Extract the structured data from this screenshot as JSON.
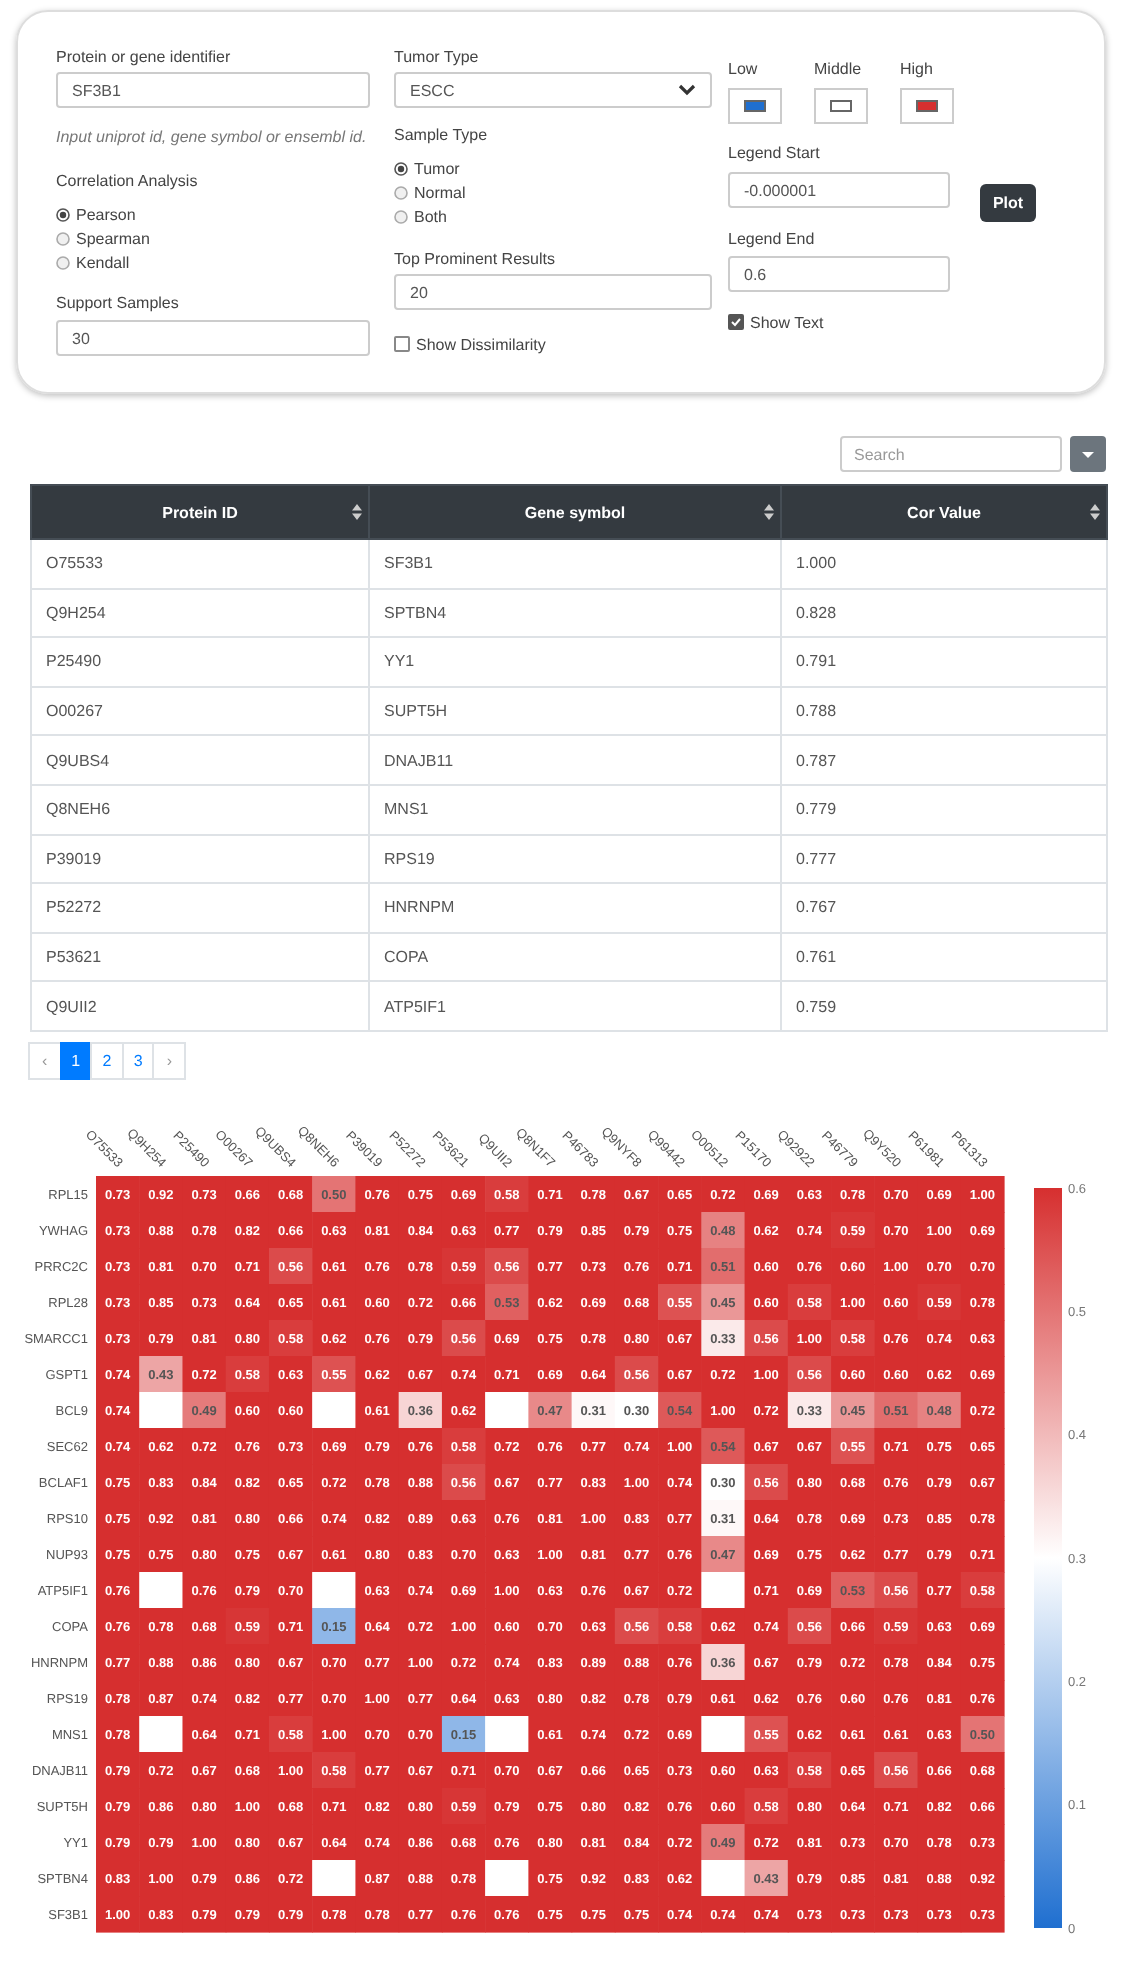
{
  "form": {
    "identifier": {
      "label": "Protein or gene identifier",
      "value": "SF3B1",
      "hint": "Input uniprot id, gene symbol or ensembl id."
    },
    "correlation": {
      "label": "Correlation Analysis",
      "options": [
        {
          "label": "Pearson",
          "selected": true
        },
        {
          "label": "Spearman",
          "selected": false
        },
        {
          "label": "Kendall",
          "selected": false
        }
      ]
    },
    "support_samples": {
      "label": "Support Samples",
      "value": "30"
    },
    "tumor_type": {
      "label": "Tumor Type",
      "value": "ESCC"
    },
    "sample_type": {
      "label": "Sample Type",
      "options": [
        {
          "label": "Tumor",
          "selected": true
        },
        {
          "label": "Normal",
          "selected": false
        },
        {
          "label": "Both",
          "selected": false
        }
      ]
    },
    "top_results": {
      "label": "Top Prominent Results",
      "value": "20"
    },
    "show_dissimilarity": {
      "label": "Show Dissimilarity",
      "checked": false
    },
    "colors": [
      {
        "label": "Low",
        "color": "#1f6fd0"
      },
      {
        "label": "Middle",
        "color": "#ffffff"
      },
      {
        "label": "High",
        "color": "#d62f2f"
      }
    ],
    "legend_start": {
      "label": "Legend Start",
      "value": "-0.000001"
    },
    "legend_end": {
      "label": "Legend End",
      "value": "0.6"
    },
    "show_text": {
      "label": "Show Text",
      "checked": true
    },
    "plot_button": "Plot"
  },
  "table": {
    "search_placeholder": "Search",
    "columns": [
      "Protein ID",
      "Gene symbol",
      "Cor Value"
    ],
    "rows": [
      [
        "O75533",
        "SF3B1",
        "1.000"
      ],
      [
        "Q9H254",
        "SPTBN4",
        "0.828"
      ],
      [
        "P25490",
        "YY1",
        "0.791"
      ],
      [
        "O00267",
        "SUPT5H",
        "0.788"
      ],
      [
        "Q9UBS4",
        "DNAJB11",
        "0.787"
      ],
      [
        "Q8NEH6",
        "MNS1",
        "0.779"
      ],
      [
        "P39019",
        "RPS19",
        "0.777"
      ],
      [
        "P52272",
        "HNRNPM",
        "0.767"
      ],
      [
        "P53621",
        "COPA",
        "0.761"
      ],
      [
        "Q9UII2",
        "ATP5IF1",
        "0.759"
      ]
    ]
  },
  "pagination": {
    "prev": "‹",
    "pages": [
      {
        "label": "1",
        "selected": true
      },
      {
        "label": "2",
        "selected": false
      },
      {
        "label": "3",
        "selected": false
      }
    ],
    "next": "›"
  },
  "heatmap": {
    "x_labels": [
      "O75533",
      "Q9H254",
      "P25490",
      "O00267",
      "Q9UBS4",
      "Q8NEH6",
      "P39019",
      "P52272",
      "P53621",
      "Q9UII2",
      "Q8N1F7",
      "P46783",
      "Q9NYF8",
      "Q99442",
      "O00512",
      "P15170",
      "Q92922",
      "P46779",
      "Q9Y520",
      "P61981",
      "P61313"
    ],
    "rows": [
      {
        "label": "RPL15",
        "cells": [
          "0.73",
          "0.92",
          "0.73",
          "0.66",
          "0.68",
          "0.50",
          "0.76",
          "0.75",
          "0.69",
          "0.58",
          "0.71",
          "0.78",
          "0.67",
          "0.65",
          "0.72",
          "0.69",
          "0.63",
          "0.78",
          "0.70",
          "0.69",
          "1.00"
        ]
      },
      {
        "label": "YWHAG",
        "cells": [
          "0.73",
          "0.88",
          "0.78",
          "0.82",
          "0.66",
          "0.63",
          "0.81",
          "0.84",
          "0.63",
          "0.77",
          "0.79",
          "0.85",
          "0.79",
          "0.75",
          "0.48",
          "0.62",
          "0.74",
          "0.59",
          "0.70",
          "1.00",
          "0.69"
        ]
      },
      {
        "label": "PRRC2C",
        "cells": [
          "0.73",
          "0.81",
          "0.70",
          "0.71",
          "0.56",
          "0.61",
          "0.76",
          "0.78",
          "0.59",
          "0.56",
          "0.77",
          "0.73",
          "0.76",
          "0.71",
          "0.51",
          "0.60",
          "0.76",
          "0.60",
          "1.00",
          "0.70",
          "0.70"
        ]
      },
      {
        "label": "RPL28",
        "cells": [
          "0.73",
          "0.85",
          "0.73",
          "0.64",
          "0.65",
          "0.61",
          "0.60",
          "0.72",
          "0.66",
          "0.53",
          "0.62",
          "0.69",
          "0.68",
          "0.55",
          "0.45",
          "0.60",
          "0.58",
          "1.00",
          "0.60",
          "0.59",
          "0.78"
        ]
      },
      {
        "label": "SMARCC1",
        "cells": [
          "0.73",
          "0.79",
          "0.81",
          "0.80",
          "0.58",
          "0.62",
          "0.76",
          "0.79",
          "0.56",
          "0.69",
          "0.75",
          "0.78",
          "0.80",
          "0.67",
          "0.33",
          "0.56",
          "1.00",
          "0.58",
          "0.76",
          "0.74",
          "0.63"
        ]
      },
      {
        "label": "GSPT1",
        "cells": [
          "0.74",
          "0.43",
          "0.72",
          "0.58",
          "0.63",
          "0.55",
          "0.62",
          "0.67",
          "0.74",
          "0.71",
          "0.69",
          "0.64",
          "0.56",
          "0.67",
          "0.72",
          "1.00",
          "0.56",
          "0.60",
          "0.60",
          "0.62",
          "0.69"
        ]
      },
      {
        "label": "BCL9",
        "cells": [
          "0.74",
          null,
          "0.49",
          "0.60",
          "0.60",
          null,
          "0.61",
          "0.36",
          "0.62",
          null,
          "0.47",
          "0.31",
          "0.30",
          "0.54",
          "1.00",
          "0.72",
          "0.33",
          "0.45",
          "0.51",
          "0.48",
          "0.72"
        ]
      },
      {
        "label": "SEC62",
        "cells": [
          "0.74",
          "0.62",
          "0.72",
          "0.76",
          "0.73",
          "0.69",
          "0.79",
          "0.76",
          "0.58",
          "0.72",
          "0.76",
          "0.77",
          "0.74",
          "1.00",
          "0.54",
          "0.67",
          "0.67",
          "0.55",
          "0.71",
          "0.75",
          "0.65"
        ]
      },
      {
        "label": "BCLAF1",
        "cells": [
          "0.75",
          "0.83",
          "0.84",
          "0.82",
          "0.65",
          "0.72",
          "0.78",
          "0.88",
          "0.56",
          "0.67",
          "0.77",
          "0.83",
          "1.00",
          "0.74",
          "0.30",
          "0.56",
          "0.80",
          "0.68",
          "0.76",
          "0.79",
          "0.67"
        ]
      },
      {
        "label": "RPS10",
        "cells": [
          "0.75",
          "0.92",
          "0.81",
          "0.80",
          "0.66",
          "0.74",
          "0.82",
          "0.89",
          "0.63",
          "0.76",
          "0.81",
          "1.00",
          "0.83",
          "0.77",
          "0.31",
          "0.64",
          "0.78",
          "0.69",
          "0.73",
          "0.85",
          "0.78"
        ]
      },
      {
        "label": "NUP93",
        "cells": [
          "0.75",
          "0.75",
          "0.80",
          "0.75",
          "0.67",
          "0.61",
          "0.80",
          "0.83",
          "0.70",
          "0.63",
          "1.00",
          "0.81",
          "0.77",
          "0.76",
          "0.47",
          "0.69",
          "0.75",
          "0.62",
          "0.77",
          "0.79",
          "0.71"
        ]
      },
      {
        "label": "ATP5IF1",
        "cells": [
          "0.76",
          null,
          "0.76",
          "0.79",
          "0.70",
          null,
          "0.63",
          "0.74",
          "0.69",
          "1.00",
          "0.63",
          "0.76",
          "0.67",
          "0.72",
          null,
          "0.71",
          "0.69",
          "0.53",
          "0.56",
          "0.77",
          "0.58"
        ]
      },
      {
        "label": "COPA",
        "cells": [
          "0.76",
          "0.78",
          "0.68",
          "0.59",
          "0.71",
          "0.15",
          "0.64",
          "0.72",
          "1.00",
          "0.60",
          "0.70",
          "0.63",
          "0.56",
          "0.58",
          "0.62",
          "0.74",
          "0.56",
          "0.66",
          "0.59",
          "0.63",
          "0.69"
        ]
      },
      {
        "label": "HNRNPM",
        "cells": [
          "0.77",
          "0.88",
          "0.86",
          "0.80",
          "0.67",
          "0.70",
          "0.77",
          "1.00",
          "0.72",
          "0.74",
          "0.83",
          "0.89",
          "0.88",
          "0.76",
          "0.36",
          "0.67",
          "0.79",
          "0.72",
          "0.78",
          "0.84",
          "0.75"
        ]
      },
      {
        "label": "RPS19",
        "cells": [
          "0.78",
          "0.87",
          "0.74",
          "0.82",
          "0.77",
          "0.70",
          "1.00",
          "0.77",
          "0.64",
          "0.63",
          "0.80",
          "0.82",
          "0.78",
          "0.79",
          "0.61",
          "0.62",
          "0.76",
          "0.60",
          "0.76",
          "0.81",
          "0.76"
        ]
      },
      {
        "label": "MNS1",
        "cells": [
          "0.78",
          null,
          "0.64",
          "0.71",
          "0.58",
          "1.00",
          "0.70",
          "0.70",
          "0.15",
          null,
          "0.61",
          "0.74",
          "0.72",
          "0.69",
          null,
          "0.55",
          "0.62",
          "0.61",
          "0.61",
          "0.63",
          "0.50"
        ]
      },
      {
        "label": "DNAJB11",
        "cells": [
          "0.79",
          "0.72",
          "0.67",
          "0.68",
          "1.00",
          "0.58",
          "0.77",
          "0.67",
          "0.71",
          "0.70",
          "0.67",
          "0.66",
          "0.65",
          "0.73",
          "0.60",
          "0.63",
          "0.58",
          "0.65",
          "0.56",
          "0.66",
          "0.68"
        ]
      },
      {
        "label": "SUPT5H",
        "cells": [
          "0.79",
          "0.86",
          "0.80",
          "1.00",
          "0.68",
          "0.71",
          "0.82",
          "0.80",
          "0.59",
          "0.79",
          "0.75",
          "0.80",
          "0.82",
          "0.76",
          "0.60",
          "0.58",
          "0.80",
          "0.64",
          "0.71",
          "0.82",
          "0.66"
        ]
      },
      {
        "label": "YY1",
        "cells": [
          "0.79",
          "0.79",
          "1.00",
          "0.80",
          "0.67",
          "0.64",
          "0.74",
          "0.86",
          "0.68",
          "0.76",
          "0.80",
          "0.81",
          "0.84",
          "0.72",
          "0.49",
          "0.72",
          "0.81",
          "0.73",
          "0.70",
          "0.78",
          "0.73"
        ]
      },
      {
        "label": "SPTBN4",
        "cells": [
          "0.83",
          "1.00",
          "0.79",
          "0.86",
          "0.72",
          null,
          "0.87",
          "0.88",
          "0.78",
          null,
          "0.75",
          "0.92",
          "0.83",
          "0.62",
          null,
          "0.43",
          "0.79",
          "0.85",
          "0.81",
          "0.88",
          "0.92"
        ]
      },
      {
        "label": "SF3B1",
        "cells": [
          "1.00",
          "0.83",
          "0.79",
          "0.79",
          "0.79",
          "0.78",
          "0.78",
          "0.77",
          "0.76",
          "0.76",
          "0.75",
          "0.75",
          "0.75",
          "0.74",
          "0.74",
          "0.74",
          "0.73",
          "0.73",
          "0.73",
          "0.73",
          "0.73"
        ]
      }
    ],
    "colorbar_ticks": [
      "0.6",
      "0.5",
      "0.4",
      "0.3",
      "0.2",
      "0.1",
      "0"
    ]
  }
}
